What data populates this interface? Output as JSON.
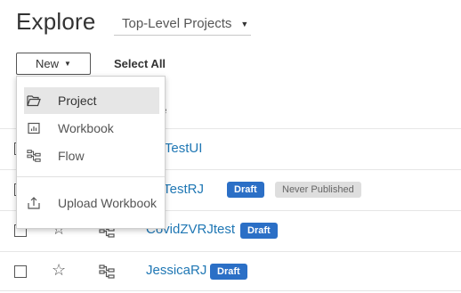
{
  "header": {
    "title": "Explore",
    "scope_select": "Top-Level Projects"
  },
  "toolbar": {
    "new_label": "New",
    "select_all_label": "Select All"
  },
  "table": {
    "name_header_visible": "ne"
  },
  "rows": [
    {
      "name_visible": "tonTestUI",
      "badges": []
    },
    {
      "name_visible": "vidTestRJ",
      "badges": [
        "Draft",
        "Never Published"
      ]
    },
    {
      "name": "CovidZVRJtest",
      "badges": [
        "Draft"
      ]
    },
    {
      "name": "JessicaRJ",
      "badges": [
        "Draft"
      ]
    }
  ],
  "new_menu": {
    "items": [
      {
        "label": "Project",
        "icon": "folder-open-icon",
        "active": true
      },
      {
        "label": "Workbook",
        "icon": "workbook-icon",
        "active": false
      },
      {
        "label": "Flow",
        "icon": "flow-icon",
        "active": false
      },
      {
        "label": "Upload Workbook",
        "icon": "upload-icon",
        "active": false
      }
    ]
  },
  "colors": {
    "link": "#1f77b4",
    "draft_badge": "#2b6fc6",
    "never_published_badge": "#dedede"
  }
}
